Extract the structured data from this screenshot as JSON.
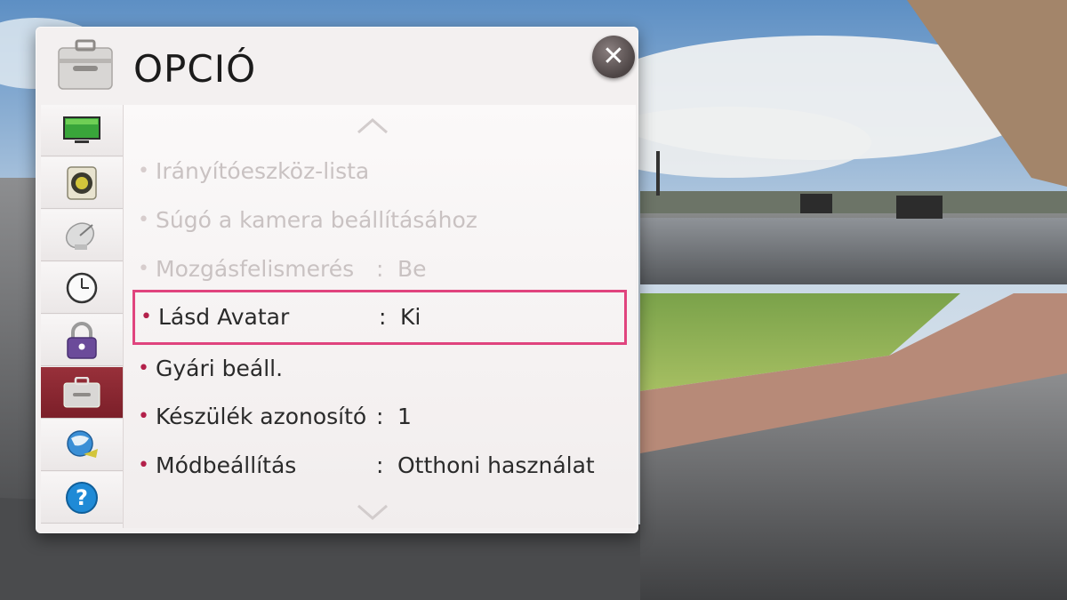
{
  "dialog": {
    "title": "OPCIÓ",
    "close_icon": "close-icon"
  },
  "sidebar": {
    "items": [
      {
        "icon": "tv-picture-icon",
        "active": false
      },
      {
        "icon": "speaker-icon",
        "active": false
      },
      {
        "icon": "satellite-dish-icon",
        "active": false
      },
      {
        "icon": "clock-icon",
        "active": false
      },
      {
        "icon": "lock-icon",
        "active": false
      },
      {
        "icon": "toolbox-icon",
        "active": true
      },
      {
        "icon": "network-globe-icon",
        "active": false
      },
      {
        "icon": "help-icon",
        "active": false
      }
    ]
  },
  "menu": {
    "items": [
      {
        "label": "Irányítóeszköz-lista",
        "value": "",
        "dim": true
      },
      {
        "label": "Súgó a kamera beállításához",
        "value": "",
        "dim": true
      },
      {
        "label": "Mozgásfelismerés",
        "value": "Be",
        "dim": true
      },
      {
        "label": "Lásd Avatar",
        "value": "Ki",
        "dim": false,
        "selected": true
      },
      {
        "label": "Gyári beáll.",
        "value": "",
        "dim": false
      },
      {
        "label": "Készülék azonosító",
        "value": "1",
        "dim": false
      },
      {
        "label": "Módbeállítás",
        "value": "Otthoni használat",
        "dim": false
      }
    ]
  },
  "colors": {
    "accent": "#e0447e",
    "active_tab": "#8a2530"
  }
}
